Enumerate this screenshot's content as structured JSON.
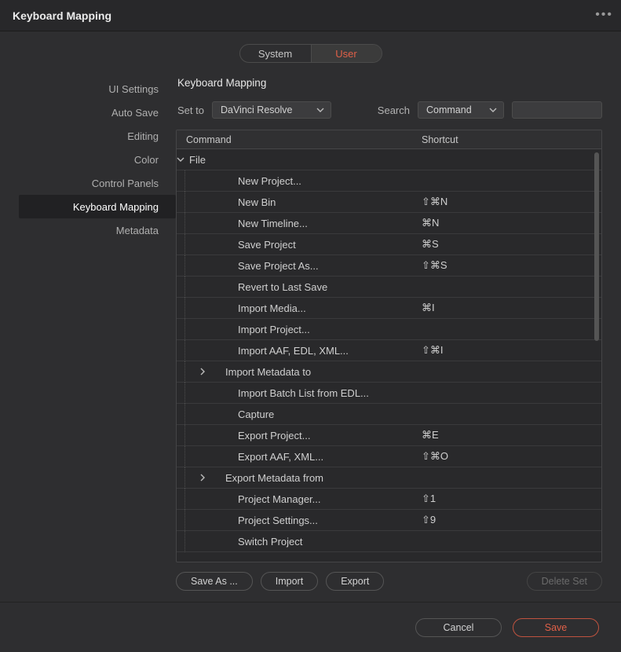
{
  "window": {
    "title": "Keyboard Mapping"
  },
  "toggle": {
    "system": "System",
    "user": "User",
    "active": "user"
  },
  "sidebar": {
    "items": [
      {
        "label": "UI Settings"
      },
      {
        "label": "Auto Save"
      },
      {
        "label": "Editing"
      },
      {
        "label": "Color"
      },
      {
        "label": "Control Panels"
      },
      {
        "label": "Keyboard Mapping",
        "active": true
      },
      {
        "label": "Metadata"
      }
    ]
  },
  "section": {
    "title": "Keyboard Mapping"
  },
  "controls": {
    "set_to_label": "Set to",
    "set_to_value": "DaVinci Resolve",
    "search_label": "Search",
    "search_mode": "Command",
    "search_value": ""
  },
  "table": {
    "headers": {
      "command": "Command",
      "shortcut": "Shortcut"
    },
    "rows": [
      {
        "type": "group",
        "label": "File"
      },
      {
        "type": "child",
        "label": "New Project...",
        "shortcut": ""
      },
      {
        "type": "child",
        "label": "New Bin",
        "shortcut": "⇧⌘N"
      },
      {
        "type": "child",
        "label": "New Timeline...",
        "shortcut": "⌘N"
      },
      {
        "type": "child",
        "label": "Save Project",
        "shortcut": "⌘S"
      },
      {
        "type": "child",
        "label": "Save Project As...",
        "shortcut": "⇧⌘S"
      },
      {
        "type": "child",
        "label": "Revert to Last Save",
        "shortcut": ""
      },
      {
        "type": "child",
        "label": "Import Media...",
        "shortcut": "⌘I"
      },
      {
        "type": "child",
        "label": "Import Project...",
        "shortcut": ""
      },
      {
        "type": "child",
        "label": "Import AAF, EDL, XML...",
        "shortcut": "⇧⌘I"
      },
      {
        "type": "sub",
        "label": "Import Metadata to",
        "shortcut": ""
      },
      {
        "type": "child",
        "label": "Import Batch List from EDL...",
        "shortcut": ""
      },
      {
        "type": "child",
        "label": "Capture",
        "shortcut": ""
      },
      {
        "type": "child",
        "label": "Export Project...",
        "shortcut": "⌘E"
      },
      {
        "type": "child",
        "label": "Export AAF, XML...",
        "shortcut": "⇧⌘O"
      },
      {
        "type": "sub",
        "label": "Export Metadata from",
        "shortcut": ""
      },
      {
        "type": "child",
        "label": "Project Manager...",
        "shortcut": "⇧1"
      },
      {
        "type": "child",
        "label": "Project Settings...",
        "shortcut": "⇧9"
      },
      {
        "type": "child",
        "label": "Switch Project",
        "shortcut": ""
      }
    ]
  },
  "buttons": {
    "save_as": "Save As ...",
    "import": "Import",
    "export": "Export",
    "delete_set": "Delete Set",
    "cancel": "Cancel",
    "save": "Save"
  }
}
